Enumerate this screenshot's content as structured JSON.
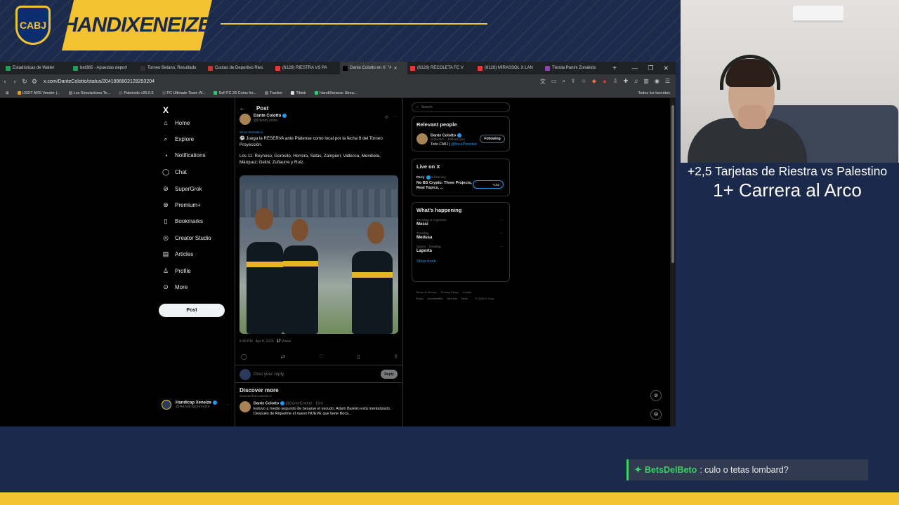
{
  "overlay": {
    "brand": "HANDIXENEIZE",
    "crest_text": "CABJ",
    "colors": {
      "navy": "#1b2a4a",
      "gold": "#f2c230",
      "chat_green": "#3ecf6a"
    }
  },
  "browser": {
    "tabs": [
      {
        "label": "Estadísticas de Walter",
        "color": "#1f9d55"
      },
      {
        "label": "bet365 - Apuestas deport",
        "color": "#1f9d55"
      },
      {
        "label": "Torneo Betano, Resultado",
        "color": "#333"
      },
      {
        "label": "Cuotas de Deportivo Ries",
        "color": "#c0392b"
      },
      {
        "label": "(6126) RIESTRA VS PA",
        "color": "#e53935"
      },
      {
        "label": "Dante Colotto en X: \"#",
        "color": "#000",
        "active": true
      },
      {
        "label": "(6126) RECOLETA FC V",
        "color": "#e53935"
      },
      {
        "label": "(6126) MIRASSOL X LAN",
        "color": "#e53935"
      },
      {
        "label": "Tienda Panini Zonakids",
        "color": "#8e44ad"
      }
    ],
    "url": "x.com/DanteColotto/status/2041996802128253204",
    "bookmarks": [
      {
        "label": "USDT ARS Vender |...",
        "color": "#f39c12"
      },
      {
        "label": "Los Simuladores Te...",
        "color": "#777"
      },
      {
        "label": "Paletools v26.0.5",
        "color": "#555"
      },
      {
        "label": "FC Ultimate Team W...",
        "color": "#555"
      },
      {
        "label": "Sell FC 26 Coins for...",
        "color": "#2ecc71"
      },
      {
        "label": "Tracker",
        "color": "#777"
      },
      {
        "label": "Tiktok",
        "color": "#ddd"
      },
      {
        "label": "HandiXeneize Strea...",
        "color": "#2ecc71"
      }
    ],
    "all_bookmarks": "Todos los favoritos"
  },
  "x": {
    "logo": "X",
    "nav": [
      {
        "label": "Home",
        "icon": "home-icon",
        "glyph": "⌂"
      },
      {
        "label": "Explore",
        "icon": "search-icon",
        "glyph": "⌕"
      },
      {
        "label": "Notifications",
        "icon": "bell-icon",
        "glyph": "◔"
      },
      {
        "label": "Chat",
        "icon": "chat-icon",
        "glyph": "◯"
      },
      {
        "label": "SuperGrok",
        "icon": "grok-icon",
        "glyph": "⊘"
      },
      {
        "label": "Premium+",
        "icon": "premium-icon",
        "glyph": "⊛"
      },
      {
        "label": "Bookmarks",
        "icon": "bookmark-icon",
        "glyph": "▯"
      },
      {
        "label": "Creator Studio",
        "icon": "creator-icon",
        "glyph": "◎"
      },
      {
        "label": "Articles",
        "icon": "articles-icon",
        "glyph": "▤"
      },
      {
        "label": "Profile",
        "icon": "profile-icon",
        "glyph": "♙"
      },
      {
        "label": "More",
        "icon": "more-icon",
        "glyph": "⊙"
      }
    ],
    "post_button": "Post",
    "account": {
      "name": "Handicap Xeneize",
      "handle": "@HandicapXeneize"
    },
    "post": {
      "header": "Post",
      "author": "Dante Colotto",
      "handle": "@DanteColotto",
      "translation": "Show translation",
      "text1": "⚽ Juega la RESERVA ante Platense como local por la fecha 8 del Torneo Proyección.",
      "text2": "Los 11: Reynoso; Gorosito, Herrera, Satas, Zampieri; Vallecca, Mendieta, Márquez; Gelini, Zufiaurre y Ruiz.",
      "timestamp": "6:49 PM · Apr 8, 2026 ·",
      "views_count": "17",
      "views_label": "Views",
      "reply_placeholder": "Post your reply",
      "reply_button": "Reply"
    },
    "discover": {
      "title": "Discover more",
      "subtitle": "Sourced from across X",
      "author": "Dante Colotto",
      "handle": "@DanteColotto · 15m",
      "text": "Estuvo a medio segundo de besarse el escudo. Adam Bareiro está mentalizado. Después de Riquelme el nuevo NUEVE que tiene Boca..."
    },
    "search_placeholder": "Search",
    "relevant": {
      "title": "Relevant people",
      "name": "Dante Colotto",
      "handle": "@DanteC...",
      "follows": "Follows you",
      "button": "Following",
      "bio_prefix": "Todo CABJ |",
      "bio_link": "@BocaPrioridad"
    },
    "live": {
      "title": "Live on X",
      "host": "Perry",
      "status": "is listening",
      "topic": "No BS Crypto: Three Projects, Real Topics, ...",
      "count": "+192"
    },
    "happening": {
      "title": "What's happening",
      "trends": [
        {
          "context": "Trending in Argentina",
          "topic": "Messi"
        },
        {
          "context": "Trending",
          "topic": "Medusa"
        },
        {
          "context": "Sports · Trending",
          "topic": "Laporta"
        }
      ],
      "show_more": "Show more"
    },
    "footer": [
      "Terms of Service",
      "Privacy Policy",
      "Cookie Policy",
      "Accessibility",
      "Ads info",
      "More ...",
      "© 2026 X Corp."
    ]
  },
  "stream": {
    "bet_line1": "+2,5 Tarjetas de Riestra vs Palestino",
    "bet_line2": "1+ Carrera al Arco",
    "chat_user": "BetsDelBeto",
    "chat_message": ": culo o tetas lombard?"
  }
}
